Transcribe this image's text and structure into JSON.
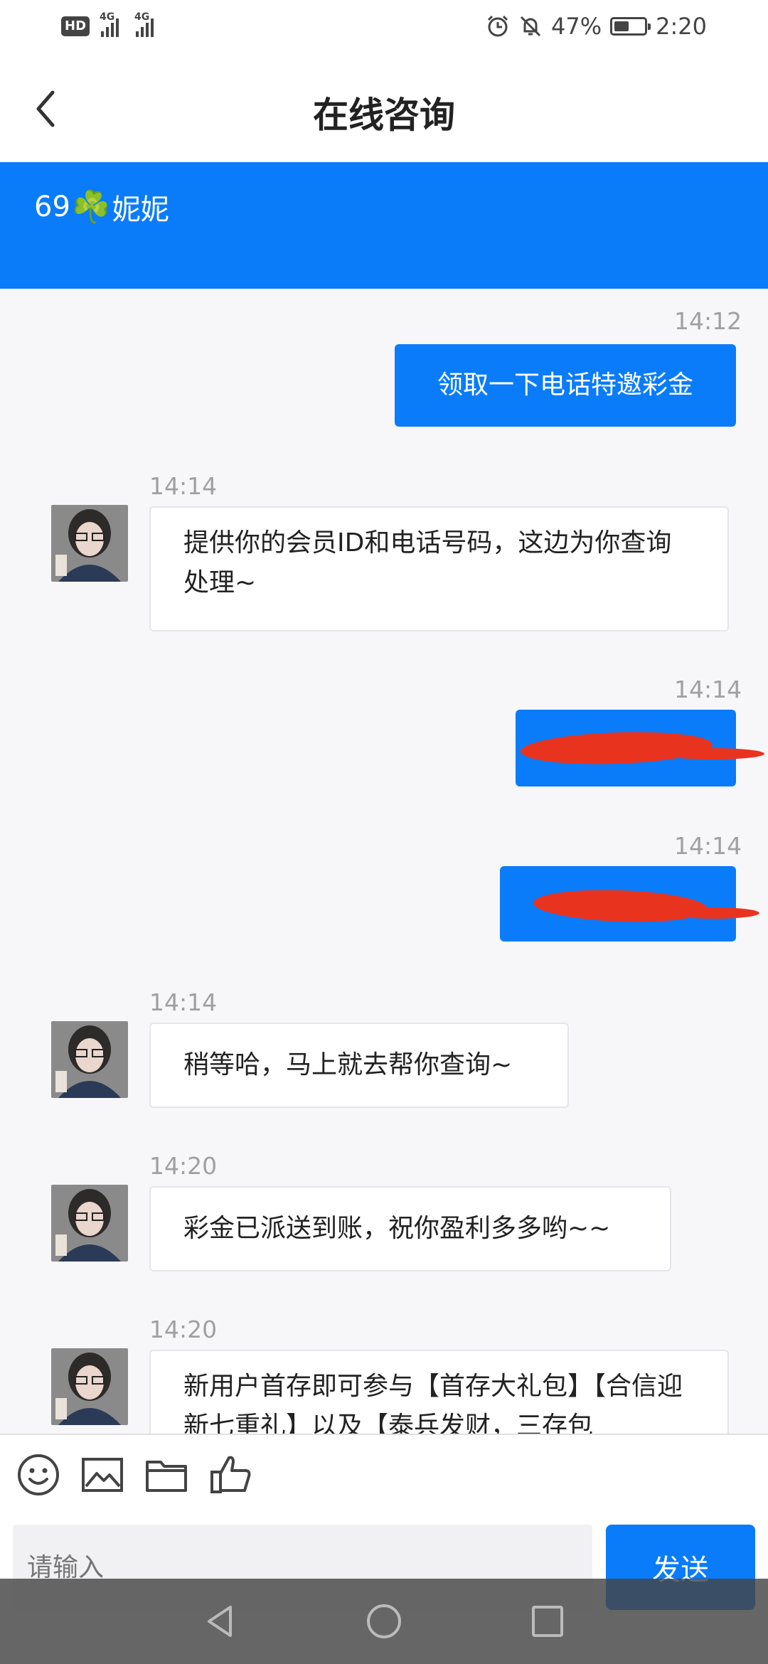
{
  "status_bar": {
    "battery_percent": "47%",
    "time": "2:20",
    "hd_label": "HD",
    "network_1": "4G",
    "network_2": "4G"
  },
  "header": {
    "title": "在线咨询",
    "back_icon": "chevron-left-icon"
  },
  "agent": {
    "prefix": "69",
    "emoji": "☘️",
    "name": "妮妮"
  },
  "messages": [
    {
      "side": "out",
      "time": "14:12",
      "text": "领取一下电话特邀彩金"
    },
    {
      "side": "in",
      "time": "14:14",
      "text": "提供你的会员ID和电话号码，这边为你查询处理~"
    },
    {
      "side": "out",
      "time": "14:14",
      "text": "",
      "redacted": true
    },
    {
      "side": "out",
      "time": "14:14",
      "text": "",
      "redacted": true
    },
    {
      "side": "in",
      "time": "14:14",
      "text": "稍等哈，马上就去帮你查询~"
    },
    {
      "side": "in",
      "time": "14:20",
      "text": "彩金已派送到账，祝你盈利多多哟~~"
    },
    {
      "side": "in",
      "time": "14:20",
      "text": "新用户首存即可参与【首存大礼包】【合信迎新七重礼】以及【泰兵发财，三存包"
    }
  ],
  "toolbar": {
    "icons": [
      "emoji-icon",
      "image-icon",
      "folder-icon",
      "thumbs-up-icon"
    ]
  },
  "composer": {
    "placeholder": "请输入",
    "send_label": "发送"
  },
  "colors": {
    "accent": "#0a7cf9",
    "redaction": "#e8331f"
  }
}
